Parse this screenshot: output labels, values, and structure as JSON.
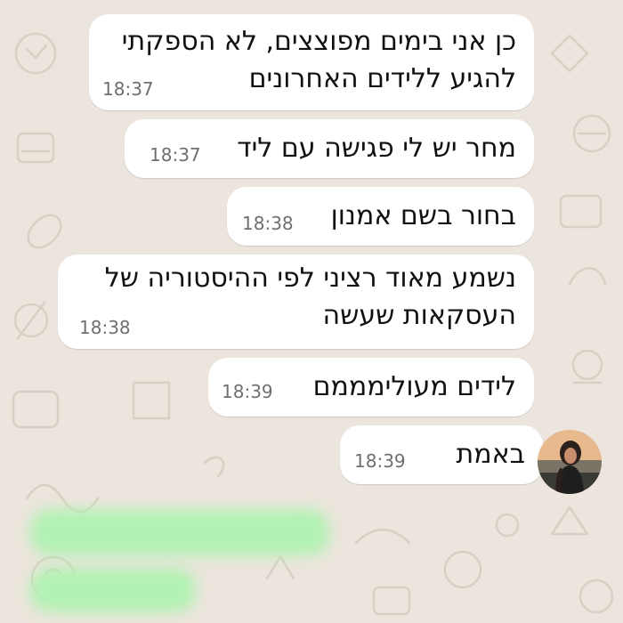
{
  "chat": {
    "messages": [
      {
        "lines": [
          "כן אני בימים מפוצצים, לא הספקתי",
          "להגיע ללידים האחרונים"
        ],
        "time": "18:37"
      },
      {
        "lines": [
          "מחר יש לי פגישה עם ליד"
        ],
        "time": "18:37"
      },
      {
        "lines": [
          "בחור בשם אמנון"
        ],
        "time": "18:38"
      },
      {
        "lines": [
          "נשמע מאוד רציני לפי ההיסטוריה של",
          "העסקאות שעשה"
        ],
        "time": "18:38"
      },
      {
        "lines": [
          "לידים מעולימממם"
        ],
        "time": "18:39"
      },
      {
        "lines": [
          "באמת"
        ],
        "time": "18:39"
      }
    ],
    "blurred_outgoing_count": 2
  },
  "colors": {
    "wallpaper": "#ece5dd",
    "incoming_bubble": "#ffffff",
    "outgoing_bubble": "#b2f2b3",
    "timestamp": "#6f6f6f"
  },
  "icons": [
    "contact-avatar-icon"
  ]
}
